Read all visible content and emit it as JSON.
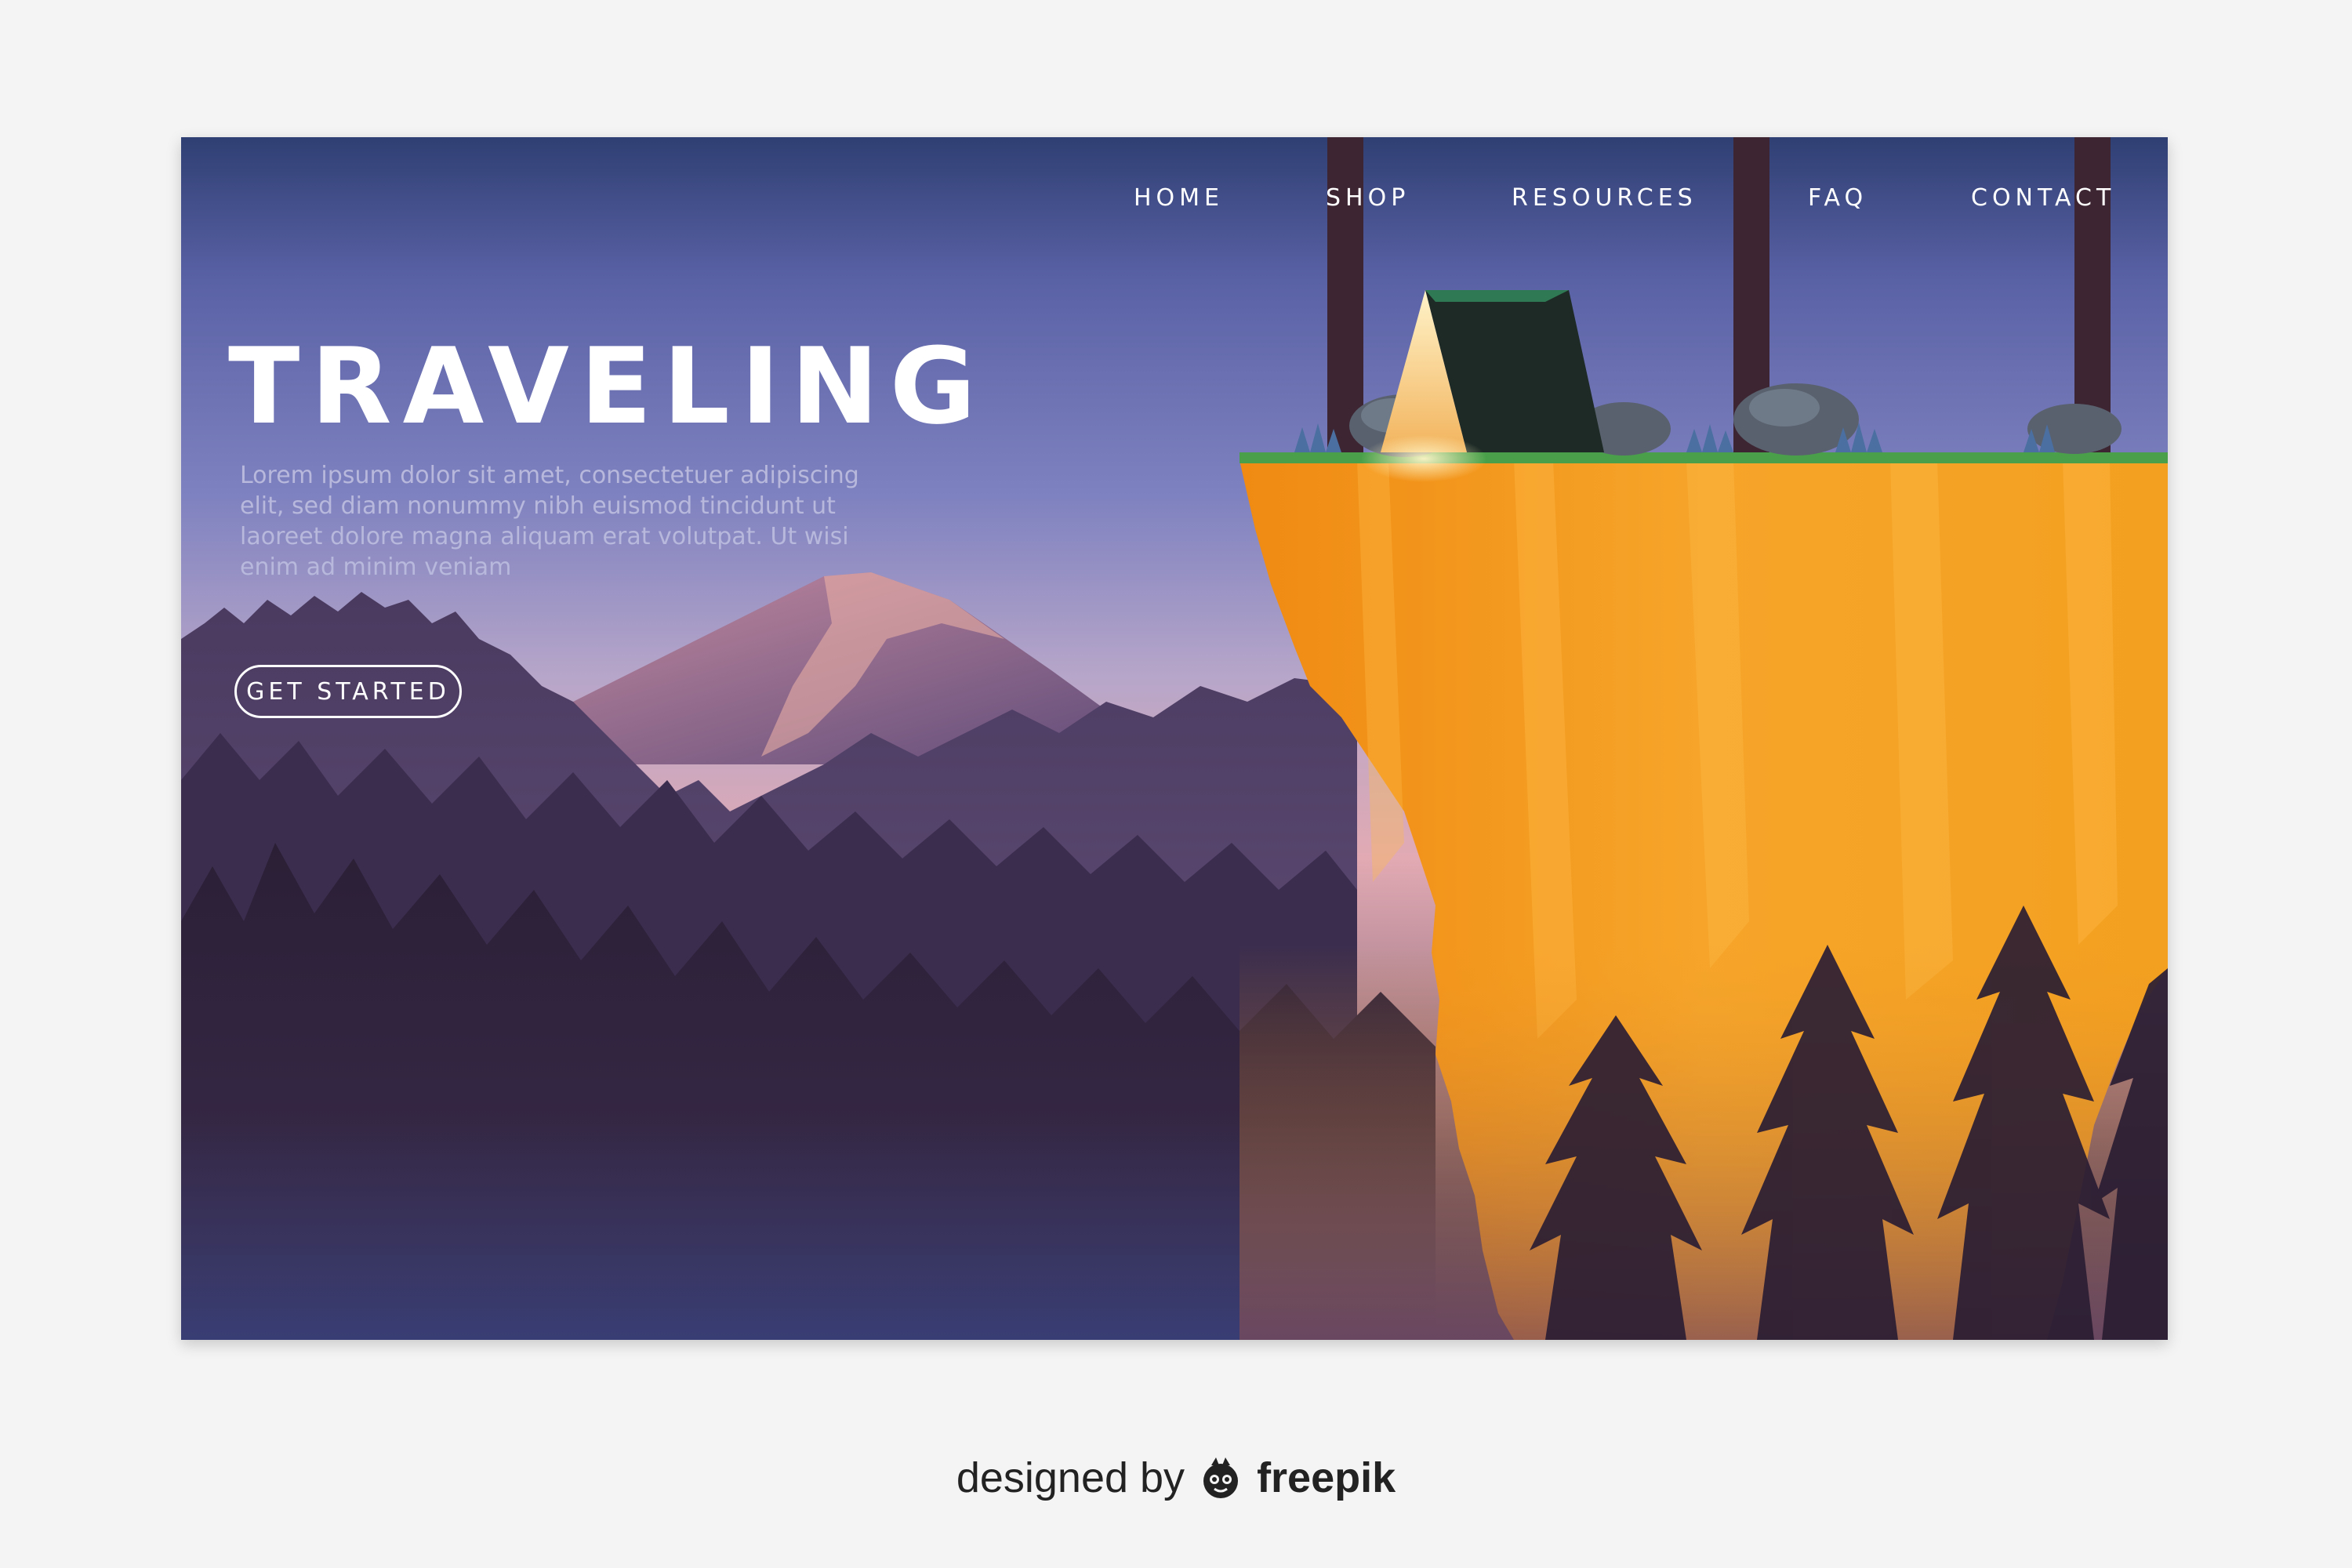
{
  "nav": {
    "items": [
      {
        "label": "HOME"
      },
      {
        "label": "SHOP"
      },
      {
        "label": "RESOURCES"
      },
      {
        "label": "FAQ"
      },
      {
        "label": "CONTACT"
      }
    ]
  },
  "hero": {
    "title": "TRAVELING",
    "body": "Lorem ipsum dolor sit amet, consectetuer adipiscing elit, sed diam nonummy nibh euismod tincidunt ut laoreet dolore magna aliquam erat volutpat. Ut wisi enim ad minim veniam",
    "cta_label": "GET STARTED"
  },
  "credit": {
    "prefix": "designed by",
    "brand": "freepik",
    "icon": "freepik-logo-icon"
  },
  "colors": {
    "sky_top": "#2f3f73",
    "sky_mid": "#6a6eb2",
    "sky_horizon": "#e4a9b0",
    "forest_dark": "#2a1d33",
    "cliff_orange": "#f4a11f",
    "grass": "#4aa04a",
    "tent_dark": "#1d2a25",
    "page_bg": "#f4f4f4"
  }
}
